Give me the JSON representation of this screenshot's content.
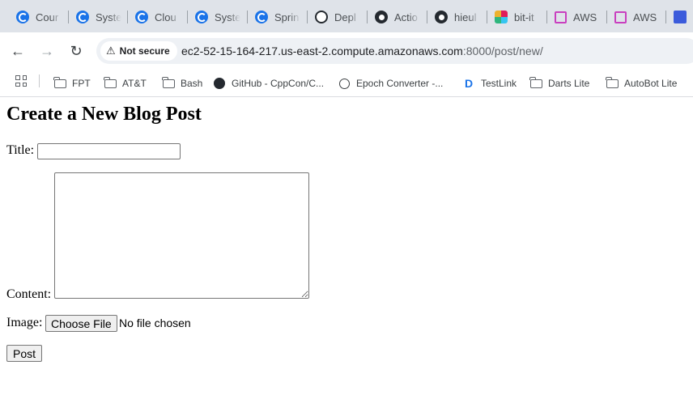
{
  "browser": {
    "tabs": [
      {
        "label": "Cour",
        "icon": "coursera-icon"
      },
      {
        "label": "Syste",
        "icon": "coursera-icon"
      },
      {
        "label": "Clou",
        "icon": "coursera-icon"
      },
      {
        "label": "Syste",
        "icon": "coursera-icon"
      },
      {
        "label": "Sprin",
        "icon": "coursera-icon"
      },
      {
        "label": "Depl",
        "icon": "github-deploy-icon"
      },
      {
        "label": "Actio",
        "icon": "github-icon"
      },
      {
        "label": "hieul",
        "icon": "github-icon"
      },
      {
        "label": "bit-it",
        "icon": "slack-icon"
      },
      {
        "label": "AWS",
        "icon": "aws-cube-icon"
      },
      {
        "label": "AWS",
        "icon": "aws-cube-icon"
      },
      {
        "label": "",
        "icon": "app-icon"
      }
    ],
    "security_label": "Not secure",
    "url_host": "ec2-52-15-164-217.us-east-2.compute.amazonaws.com",
    "url_rest": ":8000/post/new/",
    "bookmarks": [
      {
        "label": "FPT",
        "icon": "folder-icon"
      },
      {
        "label": "AT&T",
        "icon": "folder-icon"
      },
      {
        "label": "Bash",
        "icon": "folder-icon"
      },
      {
        "label": "GitHub - CppCon/C...",
        "icon": "github-icon"
      },
      {
        "label": "Epoch Converter -...",
        "icon": "clock-icon"
      },
      {
        "label": "TestLink",
        "icon": "testlink-icon"
      },
      {
        "label": "Darts Lite",
        "icon": "folder-icon"
      },
      {
        "label": "AutoBot Lite",
        "icon": "folder-icon"
      }
    ]
  },
  "form": {
    "heading": "Create a New Blog Post",
    "title_label": "Title:",
    "title_value": "",
    "content_label": "Content:",
    "content_value": "",
    "image_label": "Image:",
    "choose_file_label": "Choose File",
    "no_file_text": "No file chosen",
    "submit_label": "Post"
  }
}
